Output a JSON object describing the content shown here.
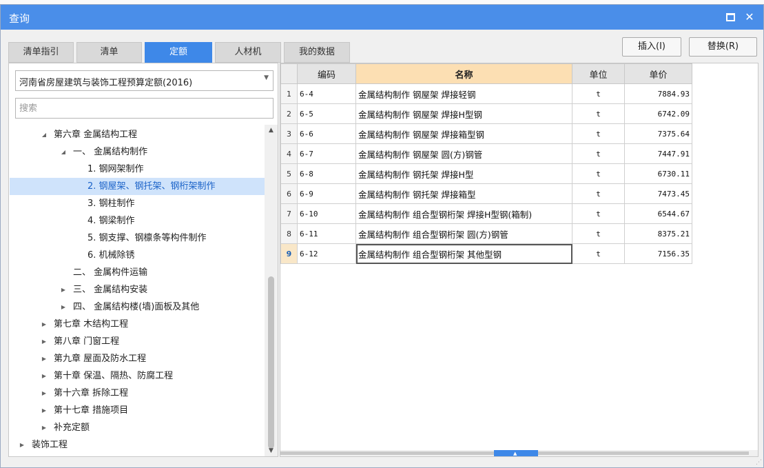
{
  "window": {
    "title": "查询"
  },
  "tabs": [
    {
      "label": "清单指引"
    },
    {
      "label": "清单"
    },
    {
      "label": "定额",
      "active": true
    },
    {
      "label": "人材机"
    },
    {
      "label": "我的数据"
    }
  ],
  "buttons": {
    "insert": "插入(I)",
    "replace": "替换(R)"
  },
  "library": {
    "selected": "河南省房屋建筑与装饰工程预算定额(2016)"
  },
  "search": {
    "placeholder": "搜索",
    "value": ""
  },
  "tree": [
    {
      "level": 1,
      "toggle": "expanded",
      "label": "第六章 金属结构工程"
    },
    {
      "level": 2,
      "toggle": "expanded",
      "label": "一、 金属结构制作"
    },
    {
      "level": 3,
      "toggle": "none",
      "label": "1. 钢网架制作"
    },
    {
      "level": 3,
      "toggle": "none",
      "label": "2. 钢屋架、钢托架、钢桁架制作",
      "selected": true
    },
    {
      "level": 3,
      "toggle": "none",
      "label": "3. 钢柱制作"
    },
    {
      "level": 3,
      "toggle": "none",
      "label": "4. 钢梁制作"
    },
    {
      "level": 3,
      "toggle": "none",
      "label": "5. 钢支撑、钢檩条等构件制作"
    },
    {
      "level": 3,
      "toggle": "none",
      "label": "6. 机械除锈"
    },
    {
      "level": 2,
      "toggle": "none",
      "label": "二、 金属构件运输"
    },
    {
      "level": 2,
      "toggle": "collapsed",
      "label": "三、 金属结构安装"
    },
    {
      "level": 2,
      "toggle": "collapsed",
      "label": "四、 金属结构楼(墙)面板及其他"
    },
    {
      "level": 1,
      "toggle": "collapsed",
      "label": "第七章 木结构工程"
    },
    {
      "level": 1,
      "toggle": "collapsed",
      "label": "第八章 门窗工程"
    },
    {
      "level": 1,
      "toggle": "collapsed",
      "label": "第九章 屋面及防水工程"
    },
    {
      "level": 1,
      "toggle": "collapsed",
      "label": "第十章 保温、隔热、防腐工程"
    },
    {
      "level": 1,
      "toggle": "collapsed",
      "label": "第十六章 拆除工程"
    },
    {
      "level": 1,
      "toggle": "collapsed",
      "label": "第十七章 措施项目"
    },
    {
      "level": 1,
      "toggle": "collapsed",
      "label": "补充定额"
    },
    {
      "level": 0,
      "toggle": "collapsed",
      "label": "装饰工程"
    }
  ],
  "table": {
    "columns": [
      "编码",
      "名称",
      "单位",
      "单价"
    ],
    "current_row": 9,
    "rows": [
      {
        "num": "1",
        "code": "6-4",
        "name": "金属结构制作 钢屋架 焊接轻钢",
        "unit": "t",
        "price": "7884.93"
      },
      {
        "num": "2",
        "code": "6-5",
        "name": "金属结构制作 钢屋架 焊接H型钢",
        "unit": "t",
        "price": "6742.09"
      },
      {
        "num": "3",
        "code": "6-6",
        "name": "金属结构制作 钢屋架 焊接箱型钢",
        "unit": "t",
        "price": "7375.64"
      },
      {
        "num": "4",
        "code": "6-7",
        "name": "金属结构制作 钢屋架 圆(方)钢管",
        "unit": "t",
        "price": "7447.91"
      },
      {
        "num": "5",
        "code": "6-8",
        "name": "金属结构制作 钢托架 焊接H型",
        "unit": "t",
        "price": "6730.11"
      },
      {
        "num": "6",
        "code": "6-9",
        "name": "金属结构制作 钢托架 焊接箱型",
        "unit": "t",
        "price": "7473.45"
      },
      {
        "num": "7",
        "code": "6-10",
        "name": "金属结构制作 组合型钢桁架 焊接H型钢(箱制)",
        "unit": "t",
        "price": "6544.67"
      },
      {
        "num": "8",
        "code": "6-11",
        "name": "金属结构制作 组合型钢桁架 圆(方)钢管",
        "unit": "t",
        "price": "8375.21"
      },
      {
        "num": "9",
        "code": "6-12",
        "name": "金属结构制作 组合型钢桁架 其他型钢",
        "unit": "t",
        "price": "7156.35"
      }
    ]
  },
  "colors": {
    "accent": "#3e88e8",
    "titlebar": "#4a8ee9",
    "selection": "#cfe3fb",
    "name_header": "#fcdfb3"
  },
  "icons": {
    "maximize": "maximize-icon",
    "close": "close-icon",
    "tree_expanded": "triangle-down-icon",
    "tree_collapsed": "triangle-right-icon"
  }
}
